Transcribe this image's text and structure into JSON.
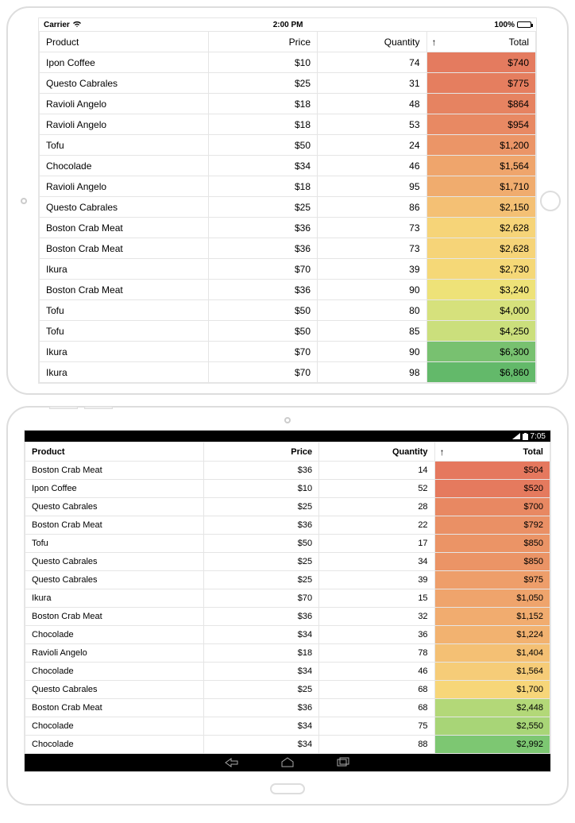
{
  "ios": {
    "status": {
      "carrier": "Carrier",
      "time": "2:00 PM",
      "battery": "100%"
    },
    "headers": {
      "product": "Product",
      "price": "Price",
      "quantity": "Quantity",
      "total": "Total",
      "sort_indicator": "↑"
    },
    "rows": [
      {
        "product": "Ipon Coffee",
        "price": "$10",
        "qty": "74",
        "total": "$740",
        "color": "#e47b5f"
      },
      {
        "product": "Questo Cabrales",
        "price": "$25",
        "qty": "31",
        "total": "$775",
        "color": "#e57e5f"
      },
      {
        "product": "Ravioli Angelo",
        "price": "$18",
        "qty": "48",
        "total": "$864",
        "color": "#e68361"
      },
      {
        "product": "Ravioli Angelo",
        "price": "$18",
        "qty": "53",
        "total": "$954",
        "color": "#e88963"
      },
      {
        "product": "Tofu",
        "price": "$50",
        "qty": "24",
        "total": "$1,200",
        "color": "#eb9567"
      },
      {
        "product": "Chocolade",
        "price": "$34",
        "qty": "46",
        "total": "$1,564",
        "color": "#efa56c"
      },
      {
        "product": "Ravioli Angelo",
        "price": "$18",
        "qty": "95",
        "total": "$1,710",
        "color": "#f0ac6e"
      },
      {
        "product": "Questo Cabrales",
        "price": "$25",
        "qty": "86",
        "total": "$2,150",
        "color": "#f4c074"
      },
      {
        "product": "Boston Crab Meat",
        "price": "$36",
        "qty": "73",
        "total": "$2,628",
        "color": "#f6d478"
      },
      {
        "product": "Boston Crab Meat",
        "price": "$36",
        "qty": "73",
        "total": "$2,628",
        "color": "#f6d478"
      },
      {
        "product": "Ikura",
        "price": "$70",
        "qty": "39",
        "total": "$2,730",
        "color": "#f5d877"
      },
      {
        "product": "Boston Crab Meat",
        "price": "$36",
        "qty": "90",
        "total": "$3,240",
        "color": "#eee278"
      },
      {
        "product": "Tofu",
        "price": "$50",
        "qty": "80",
        "total": "$4,000",
        "color": "#d6e17c"
      },
      {
        "product": "Tofu",
        "price": "$50",
        "qty": "85",
        "total": "$4,250",
        "color": "#cbdf7c"
      },
      {
        "product": "Ikura",
        "price": "$70",
        "qty": "90",
        "total": "$6,300",
        "color": "#78c170"
      },
      {
        "product": "Ikura",
        "price": "$70",
        "qty": "98",
        "total": "$6,860",
        "color": "#63b96a"
      }
    ]
  },
  "android": {
    "status": {
      "time": "7:05"
    },
    "headers": {
      "product": "Product",
      "price": "Price",
      "quantity": "Quantity",
      "total": "Total",
      "sort_indicator": "↑"
    },
    "rows": [
      {
        "product": "Boston Crab Meat",
        "price": "$36",
        "qty": "14",
        "total": "$504",
        "color": "#e5785e"
      },
      {
        "product": "Ipon Coffee",
        "price": "$10",
        "qty": "52",
        "total": "$520",
        "color": "#e57a5e"
      },
      {
        "product": "Questo Cabrales",
        "price": "$25",
        "qty": "28",
        "total": "$700",
        "color": "#e88862"
      },
      {
        "product": "Boston Crab Meat",
        "price": "$36",
        "qty": "22",
        "total": "$792",
        "color": "#ea9065"
      },
      {
        "product": "Tofu",
        "price": "$50",
        "qty": "17",
        "total": "$850",
        "color": "#eb9466"
      },
      {
        "product": "Questo Cabrales",
        "price": "$25",
        "qty": "34",
        "total": "$850",
        "color": "#eb9466"
      },
      {
        "product": "Questo Cabrales",
        "price": "$25",
        "qty": "39",
        "total": "$975",
        "color": "#ee9e6a"
      },
      {
        "product": "Ikura",
        "price": "$70",
        "qty": "15",
        "total": "$1,050",
        "color": "#efa46c"
      },
      {
        "product": "Boston Crab Meat",
        "price": "$36",
        "qty": "32",
        "total": "$1,152",
        "color": "#f1ac6f"
      },
      {
        "product": "Chocolade",
        "price": "$34",
        "qty": "36",
        "total": "$1,224",
        "color": "#f2b270"
      },
      {
        "product": "Ravioli Angelo",
        "price": "$18",
        "qty": "78",
        "total": "$1,404",
        "color": "#f4c074"
      },
      {
        "product": "Chocolade",
        "price": "$34",
        "qty": "46",
        "total": "$1,564",
        "color": "#f6cc78"
      },
      {
        "product": "Questo Cabrales",
        "price": "$25",
        "qty": "68",
        "total": "$1,700",
        "color": "#f7d679"
      },
      {
        "product": "Boston Crab Meat",
        "price": "$36",
        "qty": "68",
        "total": "$2,448",
        "color": "#b3d878"
      },
      {
        "product": "Chocolade",
        "price": "$34",
        "qty": "75",
        "total": "$2,550",
        "color": "#a8d577"
      },
      {
        "product": "Chocolade",
        "price": "$34",
        "qty": "88",
        "total": "$2,992",
        "color": "#7dc772"
      }
    ]
  }
}
